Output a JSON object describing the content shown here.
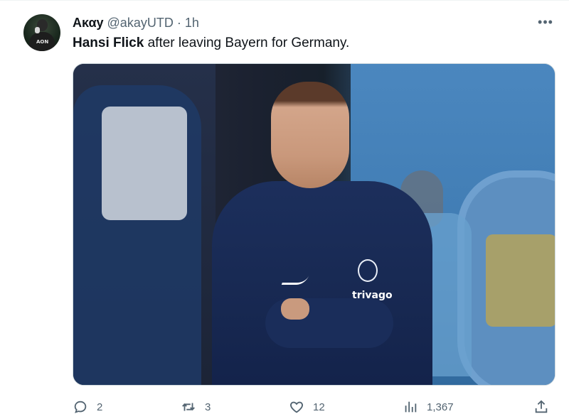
{
  "tweet": {
    "author_name": "Aκαy",
    "handle": "@akayUTD",
    "separator": "·",
    "time": "1h",
    "more_label": "•••",
    "avatar_text": "AON",
    "text_bold": "Hansi Flick",
    "text_rest": " after leaving Bayern for Germany.",
    "media_shirt_text": "trivago"
  },
  "actions": {
    "reply": {
      "icon": "reply-icon",
      "count": "2"
    },
    "retweet": {
      "icon": "retweet-icon",
      "count": "3"
    },
    "like": {
      "icon": "heart-icon",
      "count": "12"
    },
    "views": {
      "icon": "views-icon",
      "count": "1,367"
    },
    "share": {
      "icon": "share-icon",
      "count": ""
    }
  },
  "colors": {
    "text_primary": "#0f1419",
    "text_secondary": "#536471",
    "border": "#cfd9de"
  }
}
